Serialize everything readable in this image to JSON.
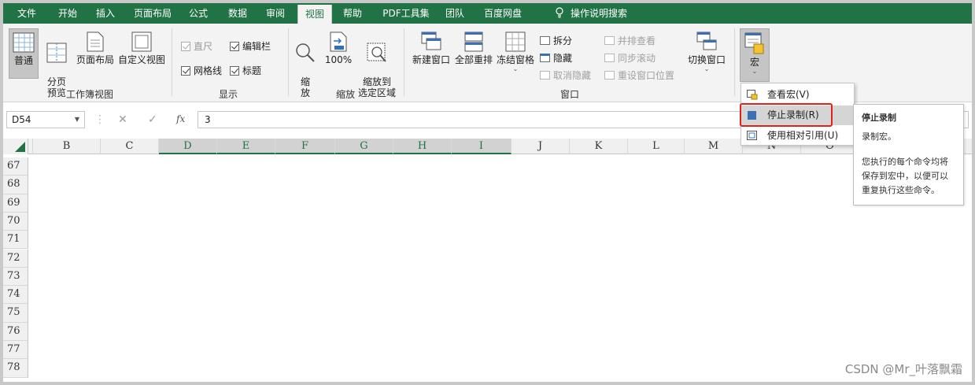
{
  "tabs": [
    {
      "label": "文件",
      "active": false
    },
    {
      "label": "开始",
      "active": false
    },
    {
      "label": "插入",
      "active": false
    },
    {
      "label": "页面布局",
      "active": false
    },
    {
      "label": "公式",
      "active": false
    },
    {
      "label": "数据",
      "active": false
    },
    {
      "label": "审阅",
      "active": false
    },
    {
      "label": "视图",
      "active": true
    },
    {
      "label": "帮助",
      "active": false
    },
    {
      "label": "PDF工具集",
      "active": false
    },
    {
      "label": "团队",
      "active": false
    },
    {
      "label": "百度网盘",
      "active": false
    }
  ],
  "tell_me": {
    "icon": "lightbulb-icon",
    "label": "操作说明搜索"
  },
  "ribbon": {
    "workbook_views": {
      "label": "工作簿视图",
      "normal": "普通",
      "page_break": "分页\n预览",
      "page_layout": "页面布局",
      "custom_views": "自定义视图"
    },
    "show": {
      "label": "显示",
      "ruler": "直尺",
      "formula_bar": "编辑栏",
      "gridlines": "网格线",
      "headings": "标题"
    },
    "zoom": {
      "label": "缩放",
      "zoom": "缩\n放",
      "hundred": "100%",
      "zoom_selection": "缩放到\n选定区域"
    },
    "window": {
      "label": "窗口",
      "new_window": "新建窗口",
      "arrange_all": "全部重排",
      "freeze_panes": "冻结窗格",
      "split": "拆分",
      "hide": "隐藏",
      "unhide": "取消隐藏",
      "side_by_side": "并排查看",
      "sync_scroll": "同步滚动",
      "reset_position": "重设窗口位置",
      "switch_windows": "切换窗口"
    },
    "macros": {
      "label": "宏"
    }
  },
  "formula_bar": {
    "name_box": "D54",
    "cancel": "✕",
    "enter": "✓",
    "fx": "fx",
    "value": "3"
  },
  "columns": [
    "B",
    "C",
    "D",
    "E",
    "F",
    "G",
    "H",
    "I",
    "J",
    "K",
    "L",
    "M",
    "N",
    "O"
  ],
  "selected_columns": [
    "D",
    "E",
    "F",
    "G",
    "H",
    "I"
  ],
  "rows": [
    "67",
    "68",
    "69",
    "70",
    "71",
    "72",
    "73",
    "74",
    "75",
    "76",
    "77",
    "78"
  ],
  "macro_menu": {
    "view_macros": "查看宏(V)",
    "stop_recording": "停止录制(R)",
    "relative_refs": "使用相对引用(U)"
  },
  "tooltip": {
    "title": "停止录制",
    "subtitle": "录制宏。",
    "body": "您执行的每个命令均将保存到宏中，以便可以重复执行这些命令。"
  },
  "watermark": "CSDN @Mr_叶落飘霜",
  "colors": {
    "brand": "#217346",
    "highlight": "#e0211d"
  }
}
